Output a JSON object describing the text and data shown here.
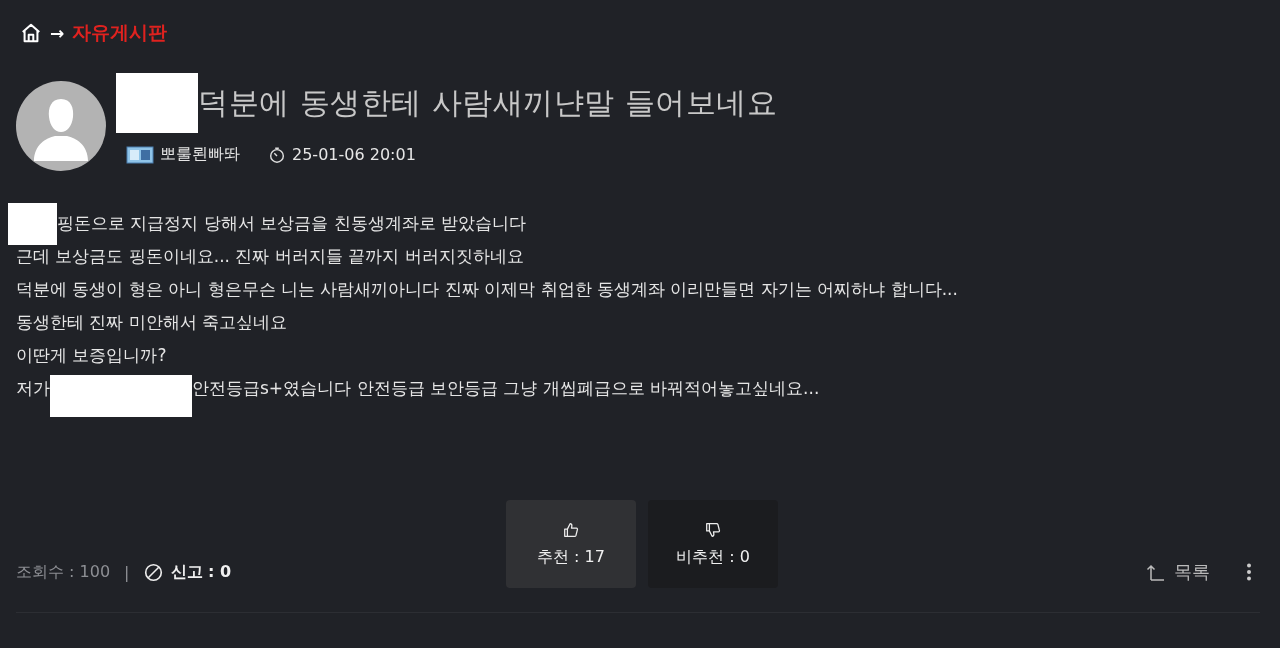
{
  "breadcrumb": {
    "separator": "→",
    "board": "자유게시판"
  },
  "post": {
    "title": [
      {
        "kind": "redacted"
      },
      {
        "kind": "text",
        "text": "덕분에 동생한테 사람새끼냔말 들어보네요"
      }
    ],
    "author": "뽀룰뢴빠똬",
    "date": "25-01-06 20:01",
    "body": [
      [
        {
          "kind": "redacted"
        },
        {
          "kind": "text",
          "text": "핑돈으로 지급정지 당해서 보상금을 친동생계좌로 받았습니다"
        }
      ],
      [
        {
          "kind": "text",
          "text": "근데 보상금도 핑돈이네요... 진짜 버러지들 끝까지 버러지짓하네요"
        }
      ],
      [
        {
          "kind": "text",
          "text": "덕분에 동생이 형은 아니 형은무슨 니는 사람새끼아니다 진짜 이제막 취업한 동생계좌 이리만들면 자기는 어찌하냐 합니다..."
        }
      ],
      [
        {
          "kind": "text",
          "text": "동생한테 진짜 미안해서 죽고싶네요"
        }
      ],
      [
        {
          "kind": "text",
          "text": "이딴게 보증입니까?"
        }
      ],
      [
        {
          "kind": "text",
          "text": "저가"
        },
        {
          "kind": "redacted"
        },
        {
          "kind": "text",
          "text": "안전등급s+였습니다 안전등급 보안등급 그냥 개씹폐급으로 바꿔적어놓고싶네요..."
        }
      ]
    ]
  },
  "votes": [
    {
      "kind": "up",
      "label": "추천 : 17",
      "selected": true
    },
    {
      "kind": "down",
      "label": "비추천 : 0",
      "selected": false
    }
  ],
  "footer": {
    "views": "조회수 : 100",
    "divider": "|",
    "report": "신고 : 0",
    "list": "목록"
  }
}
